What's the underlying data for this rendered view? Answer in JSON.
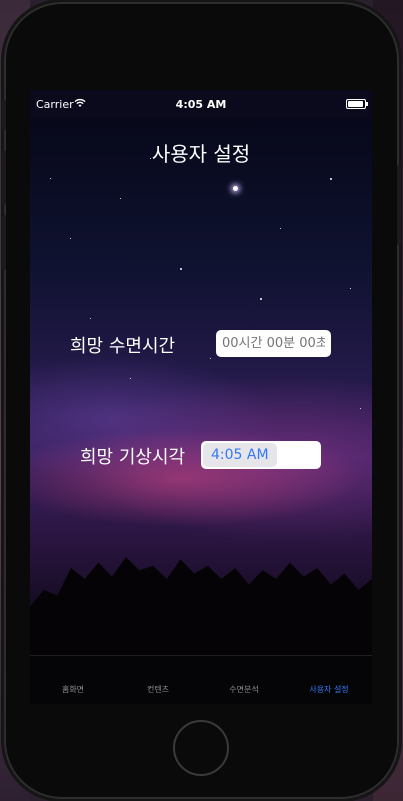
{
  "status_bar": {
    "carrier": "Carrier",
    "time": "4:05 AM"
  },
  "screen": {
    "title": "사용자 설정",
    "sleep_label": "희망 수면시간",
    "sleep_input_placeholder": "00시간 00분 00초",
    "wake_label": "희망 기상시각",
    "wake_time_value": "4:05 AM"
  },
  "tabs": [
    {
      "label": "홈화면",
      "active": false
    },
    {
      "label": "컨텐츠",
      "active": false
    },
    {
      "label": "수면분석",
      "active": false
    },
    {
      "label": "사용자 설정",
      "active": true
    }
  ],
  "colors": {
    "accent": "#3478f6",
    "inactive_tab": "#8e8e93"
  }
}
